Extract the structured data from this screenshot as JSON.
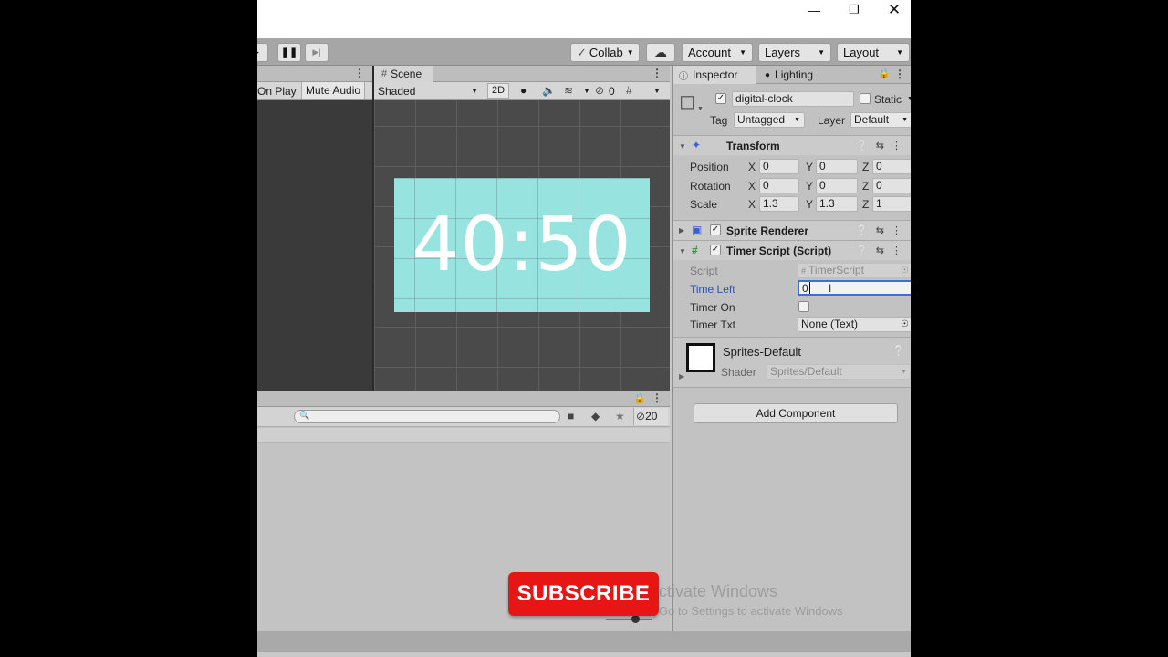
{
  "toolbar": {
    "collab_label": "Collab",
    "account_label": "Account",
    "layers_label": "Layers",
    "layout_label": "Layout"
  },
  "game_panel": {
    "maximize_on_play": "On Play",
    "mute_audio": "Mute Audio"
  },
  "scene_panel": {
    "tab_label": "Scene",
    "draw_mode": "Shaded",
    "mode_2d": "2D",
    "hidden_count": "0",
    "clock_text": "40:50"
  },
  "project_panel": {
    "hidden_count": "20"
  },
  "inspector": {
    "tab_inspector": "Inspector",
    "tab_lighting": "Lighting",
    "object_name": "digital-clock",
    "static_label": "Static",
    "tag_label": "Tag",
    "tag_value": "Untagged",
    "layer_label": "Layer",
    "layer_value": "Default",
    "transform": {
      "title": "Transform",
      "position_label": "Position",
      "rotation_label": "Rotation",
      "scale_label": "Scale",
      "axis_x": "X",
      "axis_y": "Y",
      "axis_z": "Z",
      "position": [
        "0",
        "0",
        "0"
      ],
      "rotation": [
        "0",
        "0",
        "0"
      ],
      "scale": [
        "1.3",
        "1.3",
        "1"
      ]
    },
    "sprite_renderer_title": "Sprite Renderer",
    "timer_script": {
      "title": "Timer Script (Script)",
      "script_label": "Script",
      "script_value": "TimerScript",
      "time_left_label": "Time Left",
      "time_left_value": "0",
      "timer_on_label": "Timer On",
      "timer_txt_label": "Timer Txt",
      "timer_txt_value": "None (Text)"
    },
    "material": {
      "name": "Sprites-Default",
      "shader_label": "Shader",
      "shader_value": "Sprites/Default"
    },
    "add_component_label": "Add Component"
  },
  "overlay": {
    "subscribe_label": "SUBSCRIBE",
    "watermark_line1": "ctivate Windows",
    "watermark_line2": "Go to Settings to activate Windows"
  },
  "colors": {
    "clock_background": "#96e3e0",
    "subscribe_red": "#e81515",
    "selected_field_blue": "#3c6fd8"
  }
}
